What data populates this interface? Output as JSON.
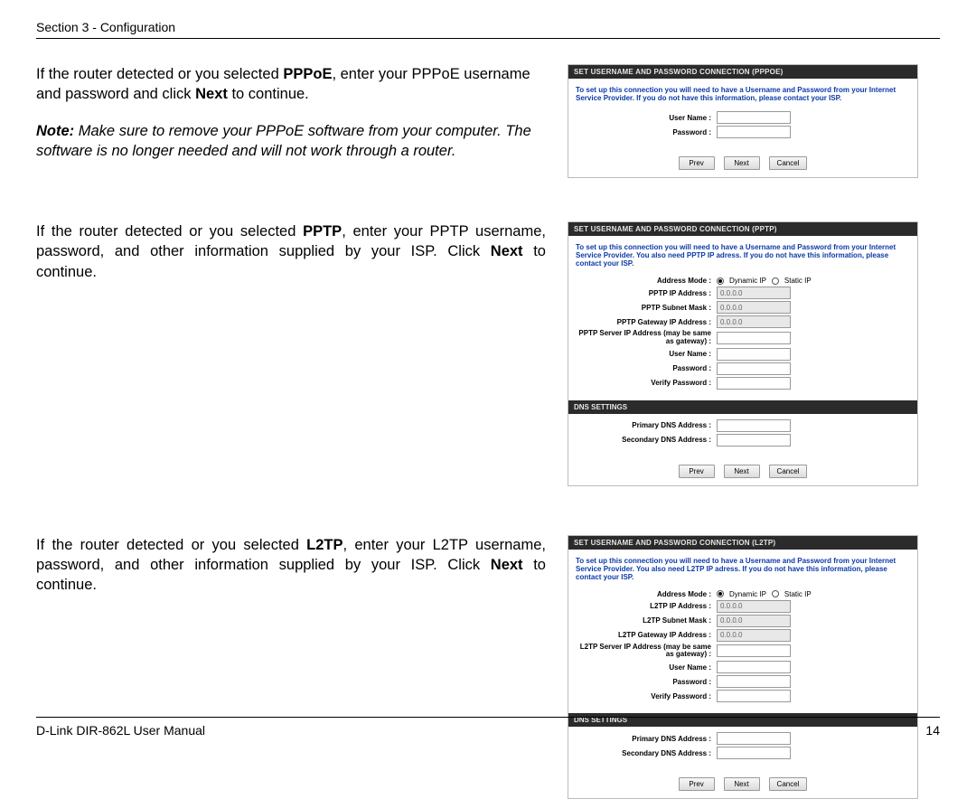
{
  "header": {
    "text": "Section 3 - Configuration"
  },
  "footer": {
    "manual": "D-Link DIR-862L User Manual",
    "page": "14"
  },
  "pppoe": {
    "para_prefix": "If the router detected or you selected ",
    "bold1": "PPPoE",
    "para_mid1": ", enter your PPPoE username and password and click ",
    "bold2": "Next",
    "para_suffix": " to continue.",
    "note_prefix": "Note:",
    "note_body": " Make sure to remove your PPPoE software from your computer. The software is no longer needed and will not work through a router.",
    "panel_title": "SET USERNAME AND PASSWORD CONNECTION (PPPOE)",
    "panel_intro": "To set up this connection you will need to have a Username and Password from your Internet Service Provider. If you do not have this information, please contact your ISP.",
    "labels": {
      "username": "User Name :",
      "password": "Password :"
    },
    "buttons": {
      "prev": "Prev",
      "next": "Next",
      "cancel": "Cancel"
    }
  },
  "pptp": {
    "para_prefix": "If the router detected or you selected ",
    "bold1": "PPTP",
    "para_mid1": ", enter your PPTP username, password, and other information supplied by your ISP. Click ",
    "bold2": "Next",
    "para_suffix": " to continue.",
    "panel_title": "SET USERNAME AND PASSWORD CONNECTION (PPTP)",
    "panel_intro": "To set up this connection you will need to have a Username and Password from your Internet Service Provider. You also need PPTP IP adress. If you do not have this information, please contact your ISP.",
    "labels": {
      "addr_mode": "Address Mode :",
      "dynamic": "Dynamic IP",
      "static": "Static IP",
      "ip": "PPTP IP Address :",
      "mask": "PPTP Subnet Mask :",
      "gw": "PPTP Gateway IP Address :",
      "server": "PPTP Server IP Address (may be same as gateway) :",
      "username": "User Name :",
      "password": "Password :",
      "verify": "Verify Password :",
      "dns_title": "DNS SETTINGS",
      "dns1": "Primary DNS Address :",
      "dns2": "Secondary DNS Address :"
    },
    "values": {
      "ip": "0.0.0.0",
      "mask": "0.0.0.0",
      "gw": "0.0.0.0"
    },
    "buttons": {
      "prev": "Prev",
      "next": "Next",
      "cancel": "Cancel"
    }
  },
  "l2tp": {
    "para_prefix": "If the router detected or you selected ",
    "bold1": "L2TP",
    "para_mid1": ", enter your L2TP username, password, and other information supplied by your ISP. Click ",
    "bold2": "Next",
    "para_suffix": " to continue.",
    "panel_title": "SET USERNAME AND PASSWORD CONNECTION (L2TP)",
    "panel_intro": "To set up this connection you will need to have a Username and Password from your Internet Service Provider. You also need L2TP IP adress. If you do not have this information, please contact your ISP.",
    "labels": {
      "addr_mode": "Address Mode :",
      "dynamic": "Dynamic IP",
      "static": "Static IP",
      "ip": "L2TP IP Address :",
      "mask": "L2TP Subnet Mask :",
      "gw": "L2TP Gateway IP Address :",
      "server": "L2TP Server IP Address (may be same as gateway) :",
      "username": "User Name :",
      "password": "Password :",
      "verify": "Verify Password :",
      "dns_title": "DNS SETTINGS",
      "dns1": "Primary DNS Address :",
      "dns2": "Secondary DNS Address :"
    },
    "values": {
      "ip": "0.0.0.0",
      "mask": "0.0.0.0",
      "gw": "0.0.0.0"
    },
    "buttons": {
      "prev": "Prev",
      "next": "Next",
      "cancel": "Cancel"
    }
  }
}
